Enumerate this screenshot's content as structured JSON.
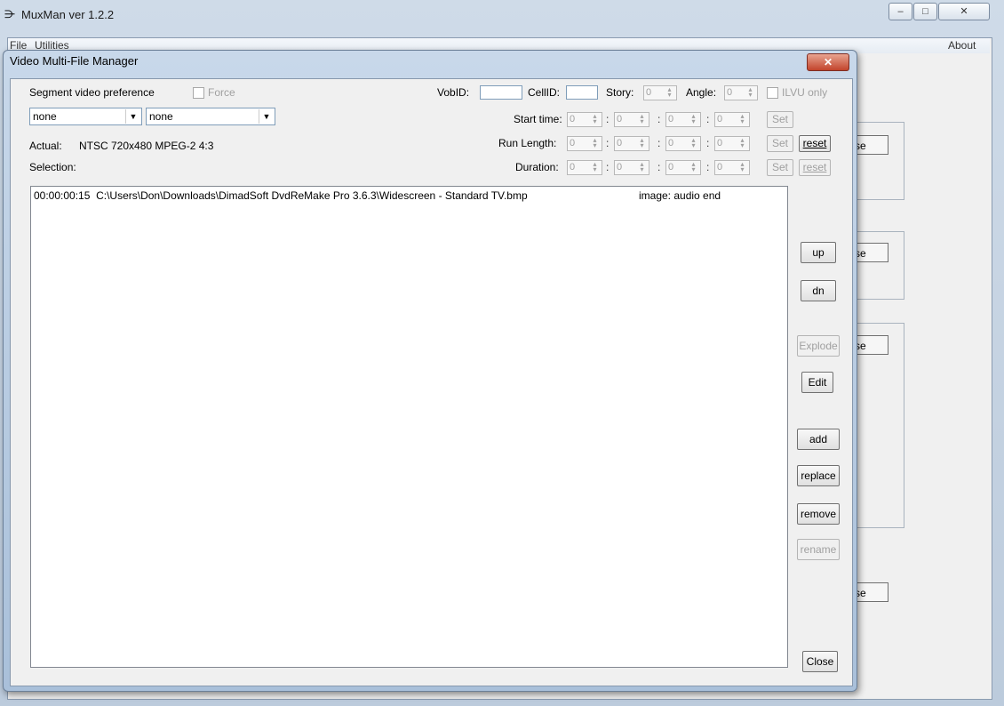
{
  "main": {
    "title": "MuxMan ver 1.2.2",
    "menu": [
      "File",
      "Utilities"
    ],
    "menu_right": "About",
    "win_buttons": [
      "–",
      "□",
      "✕"
    ],
    "group_button_label": "se"
  },
  "dialog": {
    "title": "Video Multi-File Manager",
    "close_glyph": "✕",
    "segment_pref_label": "Segment video preference",
    "force_label": "Force",
    "vobid_label": "VobID:",
    "cellid_label": "CellID:",
    "story_label": "Story:",
    "story_value": "0",
    "angle_label": "Angle:",
    "angle_value": "0",
    "ilvu_label": "ILVU only",
    "combo1_value": "none",
    "combo2_value": "none",
    "actual_label": "Actual:",
    "actual_value": "NTSC 720x480  MPEG-2  4:3",
    "selection_label": "Selection:",
    "start_time_label": "Start time:",
    "run_length_label": "Run Length:",
    "duration_label": "Duration:",
    "spin_value": "0",
    "set_label": "Set",
    "reset_label": "reset",
    "list_items": [
      {
        "time": "00:00:00:15",
        "path": "C:\\Users\\Don\\Downloads\\DimadSoft DvdReMake Pro 3.6.3\\Widescreen - Standard TV.bmp",
        "info": "image: audio end"
      }
    ],
    "buttons": {
      "up": "up",
      "dn": "dn",
      "explode": "Explode",
      "edit": "Edit",
      "add": "add",
      "replace": "replace",
      "remove": "remove",
      "rename": "rename",
      "close": "Close"
    }
  }
}
